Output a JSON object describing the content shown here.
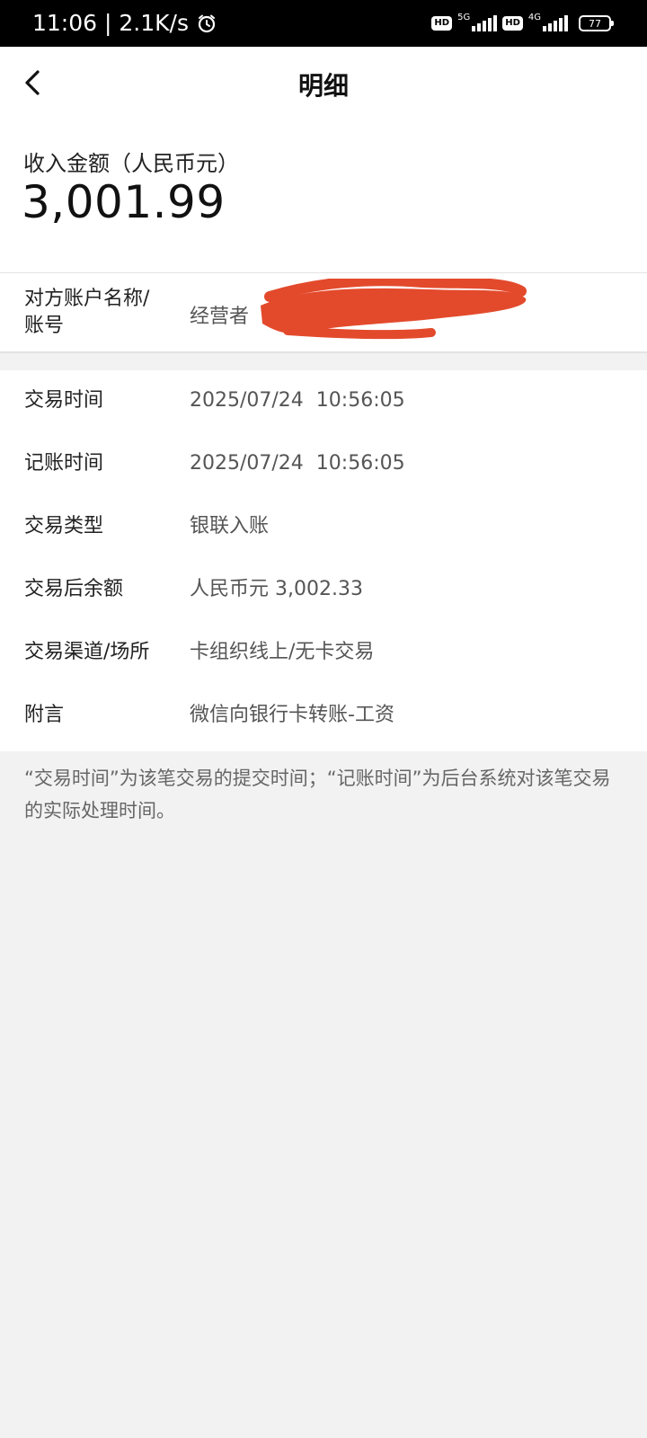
{
  "status_bar": {
    "time_speed": "11:06 | 2.1K/s",
    "hd_badge": "HD",
    "network_1": "5G",
    "network_2": "4G",
    "battery": "77"
  },
  "header": {
    "title": "明细"
  },
  "amount": {
    "label": "收入金额（人民币元）",
    "value": "3,001.99"
  },
  "account": {
    "label": "对方账户名称/账号",
    "value": "经营者",
    "redaction_color": "#e34a2c"
  },
  "details": [
    {
      "label": "交易时间",
      "value": "2025/07/24  10:56:05"
    },
    {
      "label": "记账时间",
      "value": "2025/07/24  10:56:05"
    },
    {
      "label": "交易类型",
      "value": "银联入账"
    },
    {
      "label": "交易后余额",
      "value": "人民币元 3,002.33"
    },
    {
      "label": "交易渠道/场所",
      "value": "卡组织线上/无卡交易"
    },
    {
      "label": "附言",
      "value": "微信向银行卡转账-工资"
    }
  ],
  "footnote": "“交易时间”为该笔交易的提交时间；“记账时间”为后台系统对该笔交易的实际处理时间。"
}
